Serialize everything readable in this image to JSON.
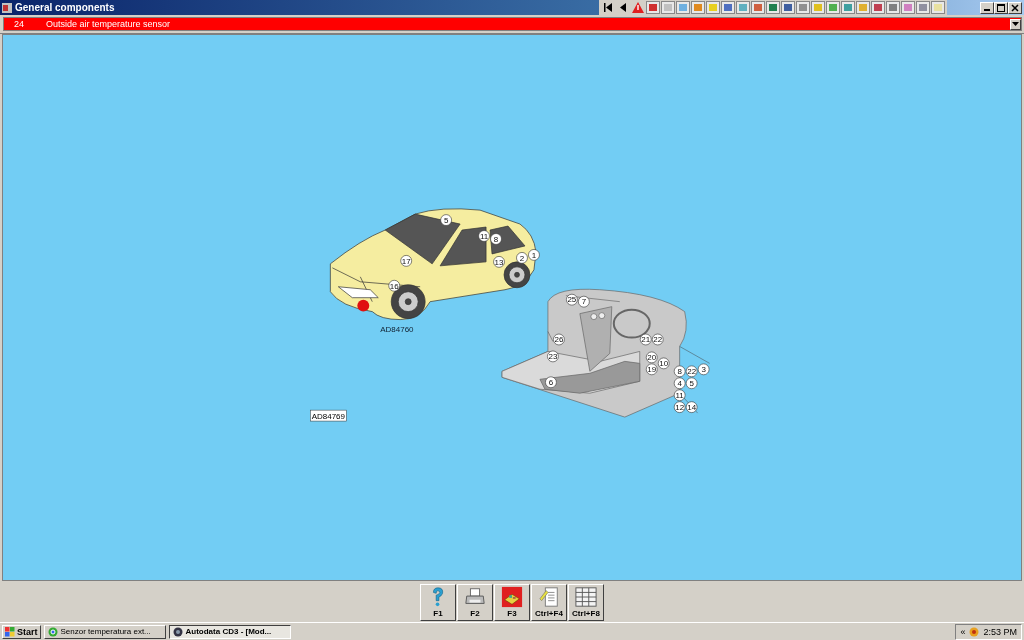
{
  "window": {
    "title": "General components"
  },
  "component_bar": {
    "number": "24",
    "name": "Outside air temperature sensor"
  },
  "diagram": {
    "car_callouts": [
      "5",
      "11",
      "8",
      "17",
      "13",
      "16",
      "2",
      "1"
    ],
    "car_code": "AD84760",
    "dashboard_callouts": [
      "25",
      "7",
      "26",
      "23",
      "21",
      "22",
      "20",
      "10",
      "19",
      "8",
      "22",
      "3",
      "4",
      "5",
      "11",
      "12",
      "14",
      "6"
    ],
    "reference": "AD84769"
  },
  "function_keys": [
    {
      "kind": "help",
      "label": "F1"
    },
    {
      "kind": "print",
      "label": "F2"
    },
    {
      "kind": "layout",
      "label": "F3"
    },
    {
      "kind": "notes",
      "label": "Ctrl+F4"
    },
    {
      "kind": "table",
      "label": "Ctrl+F8"
    }
  ],
  "taskbar": {
    "start": "Start",
    "tasks": [
      {
        "kind": "browser",
        "label": "Senzor temperatura ext...",
        "selected": false
      },
      {
        "kind": "app",
        "label": "Autodata CD3 - [Mod...",
        "selected": true
      }
    ],
    "tray_toggle": "«",
    "clock": "2:53 PM"
  }
}
